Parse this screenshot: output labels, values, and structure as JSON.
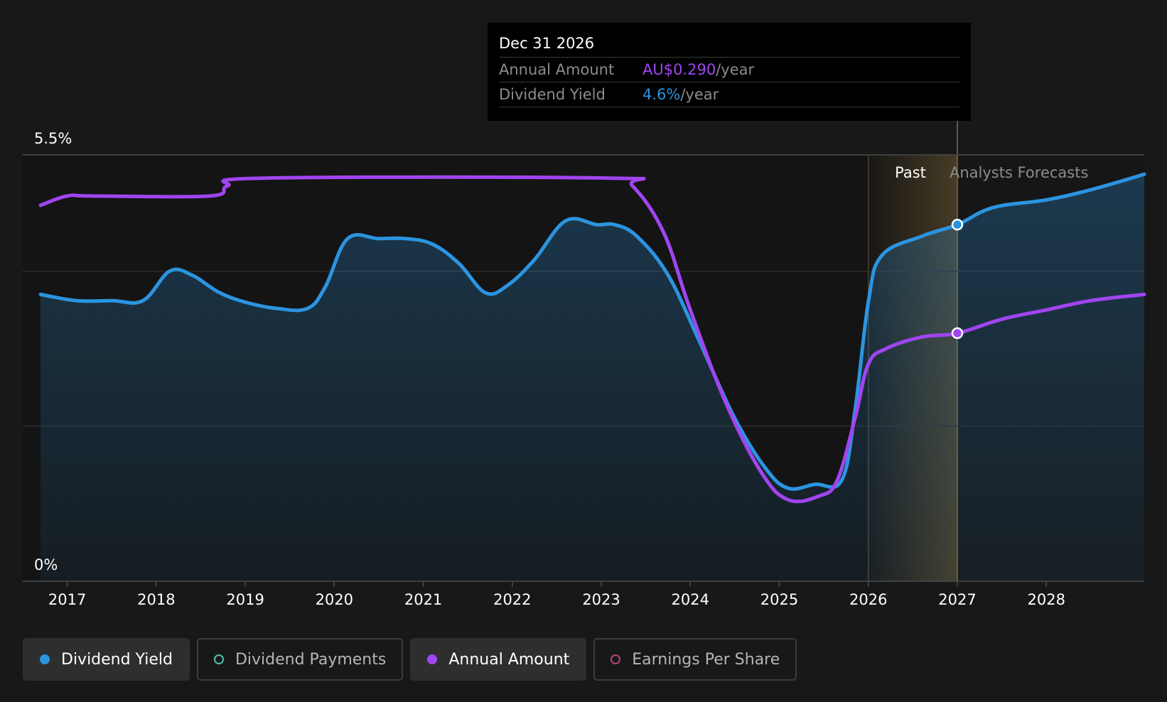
{
  "chart_data": {
    "type": "line",
    "y_axis": {
      "max_label": "5.5%",
      "min_label": "0%",
      "ylim": [
        0,
        5.5
      ]
    },
    "x_axis": {
      "ticks": [
        "2017",
        "2018",
        "2019",
        "2020",
        "2021",
        "2022",
        "2023",
        "2024",
        "2025",
        "2026",
        "2027",
        "2028"
      ],
      "xlim": [
        2016.5,
        2029.1
      ]
    },
    "regions": {
      "past_label": "Past",
      "forecast_label": "Analysts Forecasts",
      "divider_year": 2027.0,
      "past_highlight_start": 2026.0
    },
    "series": [
      {
        "name": "Dividend Yield",
        "color": "#2b94e0",
        "filled": true,
        "points": [
          [
            2016.7,
            3.7
          ],
          [
            2017.1,
            3.62
          ],
          [
            2017.5,
            3.62
          ],
          [
            2017.85,
            3.62
          ],
          [
            2018.15,
            4.0
          ],
          [
            2018.4,
            3.95
          ],
          [
            2018.7,
            3.73
          ],
          [
            2019.0,
            3.6
          ],
          [
            2019.35,
            3.52
          ],
          [
            2019.7,
            3.52
          ],
          [
            2019.9,
            3.8
          ],
          [
            2020.15,
            4.42
          ],
          [
            2020.5,
            4.42
          ],
          [
            2020.8,
            4.42
          ],
          [
            2021.1,
            4.35
          ],
          [
            2021.4,
            4.1
          ],
          [
            2021.7,
            3.72
          ],
          [
            2021.95,
            3.82
          ],
          [
            2022.25,
            4.15
          ],
          [
            2022.6,
            4.65
          ],
          [
            2022.95,
            4.6
          ],
          [
            2023.15,
            4.6
          ],
          [
            2023.4,
            4.45
          ],
          [
            2023.75,
            3.95
          ],
          [
            2024.1,
            3.1
          ],
          [
            2024.5,
            2.1
          ],
          [
            2024.85,
            1.45
          ],
          [
            2025.1,
            1.2
          ],
          [
            2025.4,
            1.25
          ],
          [
            2025.7,
            1.3
          ],
          [
            2025.85,
            2.2
          ],
          [
            2026.0,
            3.6
          ],
          [
            2026.15,
            4.2
          ],
          [
            2026.6,
            4.45
          ],
          [
            2027.0,
            4.6
          ],
          [
            2027.4,
            4.82
          ],
          [
            2028.0,
            4.92
          ],
          [
            2028.5,
            5.05
          ],
          [
            2029.1,
            5.25
          ]
        ]
      },
      {
        "name": "Annual Amount",
        "color": "#a045f0",
        "filled": false,
        "points": [
          [
            2016.7,
            4.85
          ],
          [
            2017.0,
            4.97
          ],
          [
            2017.3,
            4.97
          ],
          [
            2018.6,
            4.97
          ],
          [
            2018.8,
            5.1
          ],
          [
            2019.2,
            5.2
          ],
          [
            2023.1,
            5.2
          ],
          [
            2023.35,
            5.1
          ],
          [
            2023.7,
            4.5
          ],
          [
            2024.0,
            3.5
          ],
          [
            2024.4,
            2.3
          ],
          [
            2024.8,
            1.4
          ],
          [
            2025.1,
            1.05
          ],
          [
            2025.45,
            1.1
          ],
          [
            2025.65,
            1.3
          ],
          [
            2025.85,
            2.1
          ],
          [
            2026.0,
            2.8
          ],
          [
            2026.2,
            3.0
          ],
          [
            2026.6,
            3.15
          ],
          [
            2027.0,
            3.2
          ],
          [
            2027.5,
            3.38
          ],
          [
            2028.0,
            3.5
          ],
          [
            2028.5,
            3.62
          ],
          [
            2029.1,
            3.7
          ]
        ]
      }
    ],
    "markers": [
      {
        "series": "Dividend Yield",
        "x": 2027.0,
        "y": 4.6
      },
      {
        "series": "Annual Amount",
        "x": 2027.0,
        "y": 3.2
      }
    ]
  },
  "tooltip": {
    "date": "Dec 31 2026",
    "rows": [
      {
        "label": "Annual Amount",
        "value": "AU$0.290",
        "unit": "/year",
        "color": "#a045f0"
      },
      {
        "label": "Dividend Yield",
        "value": "4.6%",
        "unit": "/year",
        "color": "#2b94e0"
      }
    ]
  },
  "legend": [
    {
      "label": "Dividend Yield",
      "color": "#2b94e0",
      "filled": true,
      "active": true
    },
    {
      "label": "Dividend Payments",
      "color": "#4fc1b0",
      "filled": false,
      "active": false
    },
    {
      "label": "Annual Amount",
      "color": "#a045f0",
      "filled": true,
      "active": true
    },
    {
      "label": "Earnings Per Share",
      "color": "#b8437a",
      "filled": false,
      "active": false
    }
  ]
}
